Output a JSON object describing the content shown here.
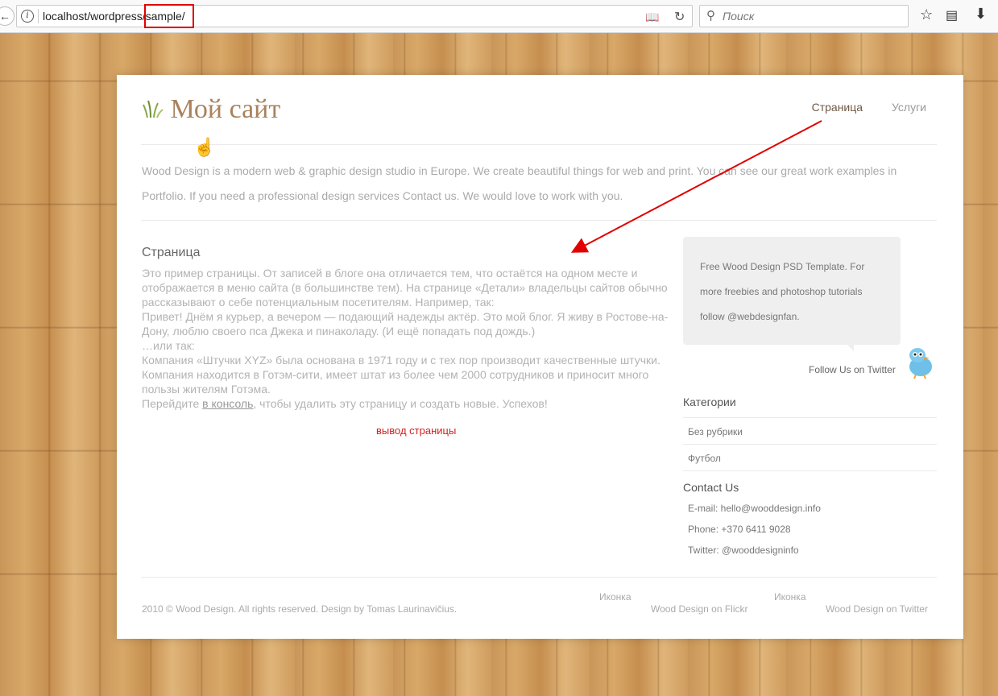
{
  "browser": {
    "url_prefix": "localhost/wordpress/",
    "url_highlight": "sample/",
    "search_placeholder": "Поиск",
    "highlight_color": "#e00000"
  },
  "site": {
    "logo_text": "Мой сайт",
    "logo_color": "#a9825c",
    "nav": [
      {
        "label": "Страница",
        "active": true
      },
      {
        "label": "Услуги",
        "active": false
      }
    ],
    "intro": "Wood Design is a modern web & graphic design studio in Europe. We create beautiful things for web and print. You can see our great work examples in Portfolio. If you need a professional design services Contact us. We would love to work with you."
  },
  "content": {
    "title": "Страница",
    "paragraphs": [
      "Это пример страницы. От записей в блоге она отличается тем, что остаётся на одном месте и отображается в меню сайта (в большинстве тем). На странице «Детали» владельцы сайтов обычно рассказывают о себе потенциальным посетителям. Например, так:",
      "Привет! Днём я курьер, а вечером — подающий надежды актёр. Это мой блог. Я живу в Ростове-на-Дону, люблю своего пса Джека и пинаколаду. (И ещё попадать под дождь.)",
      "…или так:",
      "Компания «Штучки XYZ» была основана в 1971 году и с тех пор производит качественные штучки. Компания находится в Готэм-сити, имеет штат из более чем 2000 сотрудников и приносит много пользы жителям Готэма."
    ],
    "last_before": "Перейдите ",
    "console_link": "в консоль",
    "last_after": ", чтобы удалить эту страницу и создать новые. Успехов!",
    "annotation": "вывод страницы"
  },
  "sidebar": {
    "bubble_text": "Free Wood Design PSD Template. For more freebies and photoshop tutorials follow @webdesignfan.",
    "follow": "Follow Us on Twitter",
    "categories_title": "Категории",
    "categories": [
      "Без рубрики",
      "Футбол"
    ],
    "contact_title": "Contact Us",
    "contact": {
      "email": "E-mail: hello@wooddesign.info",
      "phone": "Phone: +370 6411 9028",
      "twitter": "Twitter: @wooddesigninfo"
    }
  },
  "footer": {
    "copyright": "2010 © Wood Design. All rights reserved. Design by Tomas Laurinavičius.",
    "icon_alt_1": "Иконка",
    "flickr": "Wood Design on Flickr",
    "icon_alt_2": "Иконка",
    "twitter": "Wood Design on Twitter"
  }
}
